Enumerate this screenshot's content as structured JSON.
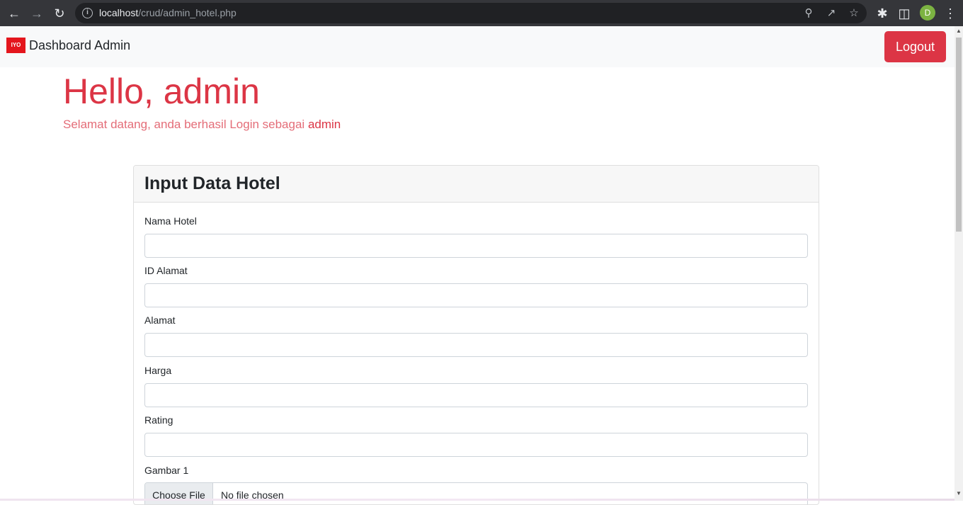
{
  "browser": {
    "url_host": "localhost",
    "url_path": "/crud/admin_hotel.php",
    "profile_initial": "D",
    "icons": [
      "back-icon",
      "forward-icon",
      "reload-icon",
      "info-icon",
      "zoom-icon",
      "share-icon",
      "star-icon",
      "extensions-icon",
      "sidepanel-icon",
      "menu-icon"
    ]
  },
  "navbar": {
    "logo_text": "IYO",
    "brand": "Dashboard Admin",
    "logout": "Logout"
  },
  "hero": {
    "hello": "Hello,",
    "username": "admin",
    "welcome": "Selamat datang, anda berhasil Login sebagai",
    "welcome_user": "admin"
  },
  "form": {
    "title": "Input Data Hotel",
    "fields": [
      {
        "label": "Nama Hotel",
        "value": ""
      },
      {
        "label": "ID Alamat",
        "value": ""
      },
      {
        "label": "Alamat",
        "value": ""
      },
      {
        "label": "Harga",
        "value": ""
      },
      {
        "label": "Rating",
        "value": ""
      }
    ],
    "file_field": {
      "label": "Gambar 1",
      "button": "Choose File",
      "status": "No file chosen"
    }
  },
  "colors": {
    "danger": "#dc3545",
    "chrome": "#35363a",
    "navbar_bg": "#f8f9fa"
  }
}
